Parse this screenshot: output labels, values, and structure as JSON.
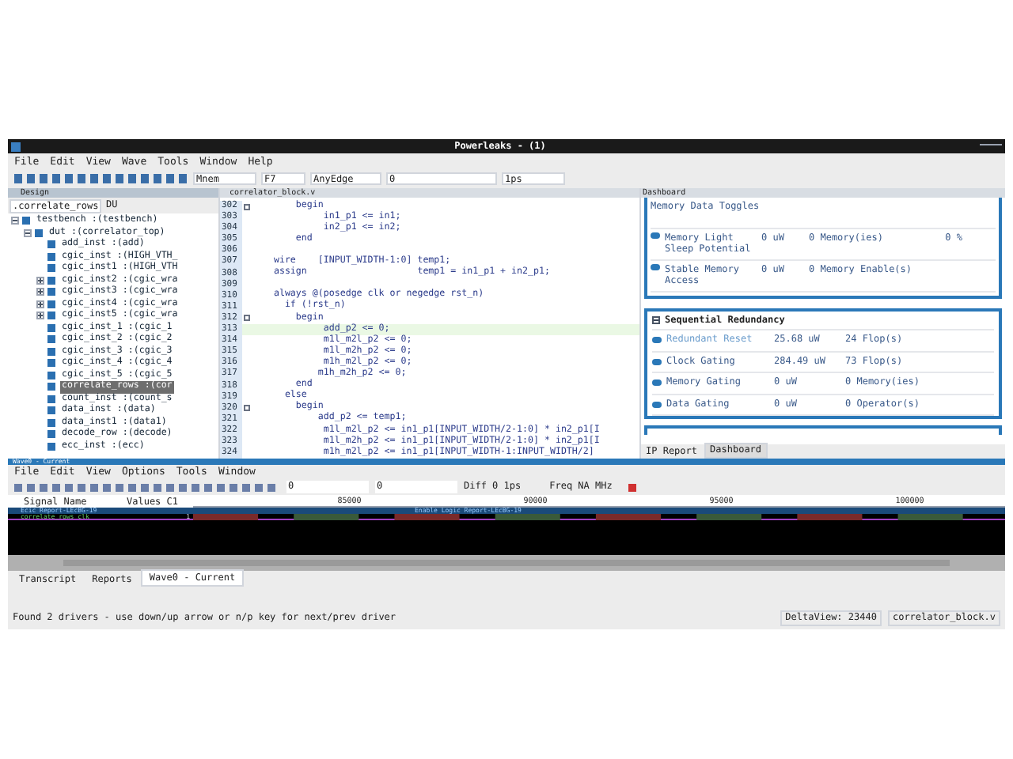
{
  "window": {
    "title": "Powerleaks - (1)"
  },
  "menu": [
    "File",
    "Edit",
    "View",
    "Wave",
    "Tools",
    "Window",
    "Help"
  ],
  "toolbar": {
    "mode": "Mnem",
    "key": "F7",
    "edge": "AnyEdge",
    "value": "0",
    "unit": "1ps"
  },
  "design": {
    "title": "Design",
    "scope": ".correlate_rows",
    "du": "DU",
    "tree": [
      {
        "label": "testbench :(testbench)",
        "expanded": true,
        "selected": false,
        "children": [
          {
            "label": "dut :(correlator_top)",
            "expanded": true,
            "selected": false,
            "children": [
              {
                "label": "add_inst :(add)",
                "selected": false
              },
              {
                "label": "cgic_inst :(HIGH_VTH_",
                "selected": false
              },
              {
                "label": "cgic_inst1 :(HIGH_VTH",
                "selected": false
              },
              {
                "label": "cgic_inst2 :(cgic_wra",
                "expanded": false,
                "selected": false
              },
              {
                "label": "cgic_inst3 :(cgic_wra",
                "expanded": false,
                "selected": false
              },
              {
                "label": "cgic_inst4 :(cgic_wra",
                "expanded": false,
                "selected": false
              },
              {
                "label": "cgic_inst5 :(cgic_wra",
                "expanded": false,
                "selected": false
              },
              {
                "label": "cgic_inst_1 :(cgic_1",
                "selected": false
              },
              {
                "label": "cgic_inst_2 :(cgic_2",
                "selected": false
              },
              {
                "label": "cgic_inst_3 :(cgic_3",
                "selected": false
              },
              {
                "label": "cgic_inst_4 :(cgic_4",
                "selected": false
              },
              {
                "label": "cgic_inst_5 :(cgic_5",
                "selected": false
              },
              {
                "label": "correlate_rows :(cor",
                "selected": true
              },
              {
                "label": "count_inst :(count_s",
                "selected": false
              },
              {
                "label": "data_inst :(data)",
                "selected": false
              },
              {
                "label": "data_inst1 :(data1)",
                "selected": false
              },
              {
                "label": "decode_row :(decode)",
                "selected": false
              },
              {
                "label": "ecc_inst :(ecc)",
                "selected": false
              }
            ]
          }
        ]
      }
    ]
  },
  "editor": {
    "tab": "correlator_block.v",
    "lines": [
      {
        "num": "302",
        "code": "        begin",
        "fold": true,
        "current": false
      },
      {
        "num": "303",
        "code": "             in1_p1 <= in1;",
        "current": false
      },
      {
        "num": "304",
        "code": "             in2_p1 <= in2;",
        "current": false
      },
      {
        "num": "305",
        "code": "        end",
        "current": false
      },
      {
        "num": "306",
        "current": false
      },
      {
        "num": "307",
        "code": "    wire    [INPUT_WIDTH-1:0] temp1;",
        "current": false
      },
      {
        "num": "308",
        "code": "    assign                    temp1 = in1_p1 + in2_p1;",
        "current": false
      },
      {
        "num": "309",
        "current": false
      },
      {
        "num": "310",
        "code": "    always @(posedge clk or negedge rst_n)",
        "current": false
      },
      {
        "num": "311",
        "code": "      if (!rst_n)",
        "current": false
      },
      {
        "num": "312",
        "code": "        begin",
        "fold": true,
        "current": false
      },
      {
        "num": "313",
        "code": "             add_p2 <= 0;",
        "current": true
      },
      {
        "num": "314",
        "code": "             m1l_m2l_p2 <= 0;",
        "current": false
      },
      {
        "num": "315",
        "code": "             m1l_m2h_p2 <= 0;",
        "current": false
      },
      {
        "num": "316",
        "code": "             m1h_m2l_p2 <= 0;",
        "current": false
      },
      {
        "num": "317",
        "code": "            m1h_m2h_p2 <= 0;",
        "current": false
      },
      {
        "num": "318",
        "code": "        end",
        "current": false
      },
      {
        "num": "319",
        "code": "      else",
        "current": false
      },
      {
        "num": "320",
        "code": "        begin",
        "fold": true,
        "current": false
      },
      {
        "num": "321",
        "code": "            add_p2 <= temp1;",
        "current": false
      },
      {
        "num": "322",
        "code": "             m1l_m2l_p2 <= in1_p1[INPUT_WIDTH/2-1:0] * in2_p1[I",
        "current": false
      },
      {
        "num": "323",
        "code": "             m1l_m2h_p2 <= in1_p1[INPUT_WIDTH/2-1:0] * in2_p1[I",
        "current": false
      },
      {
        "num": "324",
        "code": "             m1h_m2l_p2 <= in1_p1[INPUT_WIDTH-1:INPUT_WIDTH/2]",
        "current": false
      }
    ]
  },
  "dashboard": {
    "title": "Dashboard",
    "top_rows": [
      {
        "name": "Memory Data Toggles"
      },
      {
        "name": "Memory Light Sleep Potential",
        "power": "0 uW",
        "count": "0 Memory(ies)",
        "pct": "0 %"
      },
      {
        "name": "Stable Memory Access",
        "power": "0 uW",
        "count": "0 Memory Enable(s)"
      }
    ],
    "section": {
      "title": "Sequential Redundancy",
      "expanded": true,
      "rows": [
        {
          "name": "Redundant Reset",
          "power": "25.68 uW",
          "count": "24 Flop(s)",
          "selected": true
        },
        {
          "name": "Clock Gating",
          "power": "284.49 uW",
          "count": "73 Flop(s)",
          "selected": false
        },
        {
          "name": "Memory Gating",
          "power": "0 uW",
          "count": "0 Memory(ies)",
          "selected": false
        },
        {
          "name": "Data Gating",
          "power": "0 uW",
          "count": "0 Operator(s)",
          "selected": false
        }
      ]
    },
    "tabs": [
      {
        "label": "IP Report",
        "selected": false
      },
      {
        "label": "Dashboard",
        "selected": true
      }
    ]
  },
  "wave": {
    "title": "Wave0 - Current",
    "menu": [
      "File",
      "Edit",
      "View",
      "Options",
      "Tools",
      "Window"
    ],
    "cursor1": "0",
    "cursor2": "0",
    "diff": "Diff 0 1ps",
    "freq": "Freq NA MHz",
    "columns": [
      "Signal Name",
      "Values C1"
    ],
    "ticks": [
      "85000",
      "90000",
      "95000",
      "100000"
    ],
    "group": "Ecic Report-LEcBG-19",
    "signal": "correlate_rows clk",
    "signal_value": "1",
    "banner": "Enable Logic Report-LEcBG-19",
    "tabs": [
      {
        "label": "Transcript",
        "selected": false
      },
      {
        "label": "Reports",
        "selected": false
      },
      {
        "label": "Wave0 - Current",
        "selected": true
      }
    ]
  },
  "status": {
    "message": "Found 2 drivers - use down/up arrow or n/p key for next/prev driver",
    "delta": "DeltaView: 23440",
    "file": "correlator_block.v"
  }
}
